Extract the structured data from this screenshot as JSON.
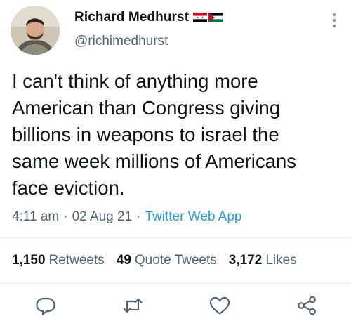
{
  "user": {
    "display_name": "Richard Medhurst",
    "handle": "@richimedhurst",
    "flags": [
      "syria-flag-icon",
      "palestine-flag-icon"
    ]
  },
  "tweet": {
    "text": "I can't think of anything more\nAmerican than Congress giving\nbillions in weapons to israel the\nsame week millions of Americans\nface eviction.",
    "time": "4:11 am",
    "separator": "·",
    "date": "02 Aug 21",
    "source": "Twitter Web App"
  },
  "stats": {
    "retweets_count": "1,150",
    "retweets_label": "Retweets",
    "quotes_count": "49",
    "quotes_label": "Quote Tweets",
    "likes_count": "3,172",
    "likes_label": "Likes"
  },
  "actions": [
    "reply-icon",
    "retweet-icon",
    "like-icon",
    "share-icon"
  ],
  "colors": {
    "text": "#0f1419",
    "secondary": "#536471",
    "accent": "#1d9bf0",
    "divider": "#e6ecf0"
  }
}
